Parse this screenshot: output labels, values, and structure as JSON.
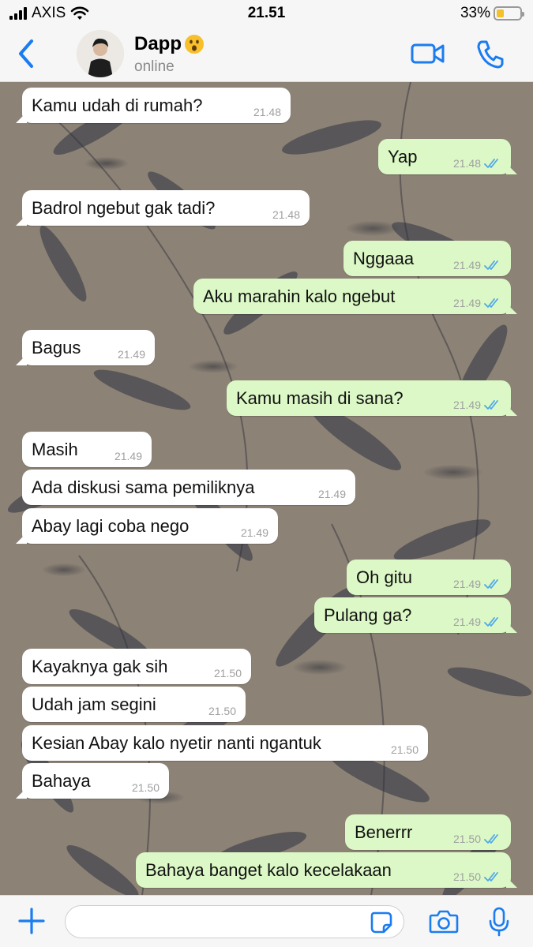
{
  "status_bar": {
    "carrier": "AXIS",
    "time": "21.51",
    "battery": "33%",
    "battery_level": 0.33
  },
  "header": {
    "contact_name": "Dapp",
    "contact_status": "online"
  },
  "colors": {
    "accent": "#1a7cf0",
    "incoming_bubble": "#ffffff",
    "outgoing_bubble": "#dcf8c6",
    "read_ticks": "#4fa8e8"
  },
  "messages": [
    {
      "dir": "in",
      "text": "Kamu udah di rumah?",
      "time": "21.48"
    },
    {
      "dir": "out",
      "text": "Yap",
      "time": "21.48"
    },
    {
      "dir": "in",
      "text": "Badrol ngebut gak tadi?",
      "time": "21.48"
    },
    {
      "dir": "out",
      "text": "Nggaaa",
      "time": "21.49"
    },
    {
      "dir": "out",
      "text": "Aku marahin kalo ngebut",
      "time": "21.49"
    },
    {
      "dir": "in",
      "text": "Bagus",
      "time": "21.49"
    },
    {
      "dir": "out",
      "text": "Kamu masih di sana?",
      "time": "21.49"
    },
    {
      "dir": "in",
      "text": "Masih",
      "time": "21.49"
    },
    {
      "dir": "in",
      "text": "Ada diskusi sama pemiliknya",
      "time": "21.49"
    },
    {
      "dir": "in",
      "text": "Abay lagi coba nego",
      "time": "21.49"
    },
    {
      "dir": "out",
      "text": "Oh gitu",
      "time": "21.49"
    },
    {
      "dir": "out",
      "text": "Pulang ga?",
      "time": "21.49"
    },
    {
      "dir": "in",
      "text": "Kayaknya gak sih",
      "time": "21.50"
    },
    {
      "dir": "in",
      "text": "Udah jam segini",
      "time": "21.50"
    },
    {
      "dir": "in",
      "text": "Kesian Abay kalo nyetir nanti ngantuk",
      "time": "21.50"
    },
    {
      "dir": "in",
      "text": "Bahaya",
      "time": "21.50"
    },
    {
      "dir": "out",
      "text": "Benerrr",
      "time": "21.50"
    },
    {
      "dir": "out",
      "text": "Bahaya banget kalo kecelakaan",
      "time": "21.50"
    }
  ],
  "input": {
    "placeholder": ""
  },
  "icons": {
    "back": "chevron-left-icon",
    "video": "video-call-icon",
    "phone": "phone-call-icon",
    "plus": "plus-icon",
    "sticker": "sticker-icon",
    "camera": "camera-icon",
    "mic": "microphone-icon"
  }
}
